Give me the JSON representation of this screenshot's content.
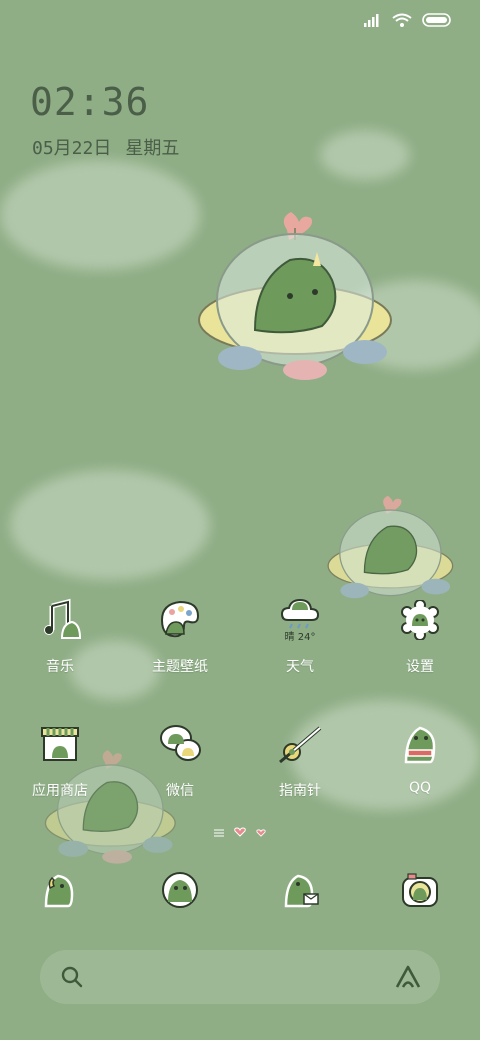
{
  "status_bar": {
    "signal_icon": "signal-icon",
    "wifi_icon": "wifi-icon",
    "battery_icon": "battery-icon"
  },
  "clock": {
    "time": "02:36",
    "date": "05月22日",
    "weekday": "星期五"
  },
  "apps_row1": [
    {
      "label": "音乐",
      "icon": "music-note-icon"
    },
    {
      "label": "主题壁纸",
      "icon": "palette-icon"
    },
    {
      "label": "天气",
      "icon": "weather-icon",
      "weather_text": "晴 24°"
    },
    {
      "label": "设置",
      "icon": "gear-icon"
    }
  ],
  "apps_row2": [
    {
      "label": "应用商店",
      "icon": "store-icon"
    },
    {
      "label": "微信",
      "icon": "chat-bubbles-icon"
    },
    {
      "label": "指南针",
      "icon": "compass-icon"
    },
    {
      "label": "QQ",
      "icon": "dino-scarf-icon"
    }
  ],
  "dock": [
    {
      "icon": "phone-dino-icon"
    },
    {
      "icon": "contacts-dino-icon"
    },
    {
      "icon": "message-dino-icon"
    },
    {
      "icon": "camera-dino-icon"
    }
  ],
  "colors": {
    "background": "#8fae86",
    "text": "#ffffff",
    "clock": "#4a5e48",
    "dino": "#6e9a5c"
  }
}
